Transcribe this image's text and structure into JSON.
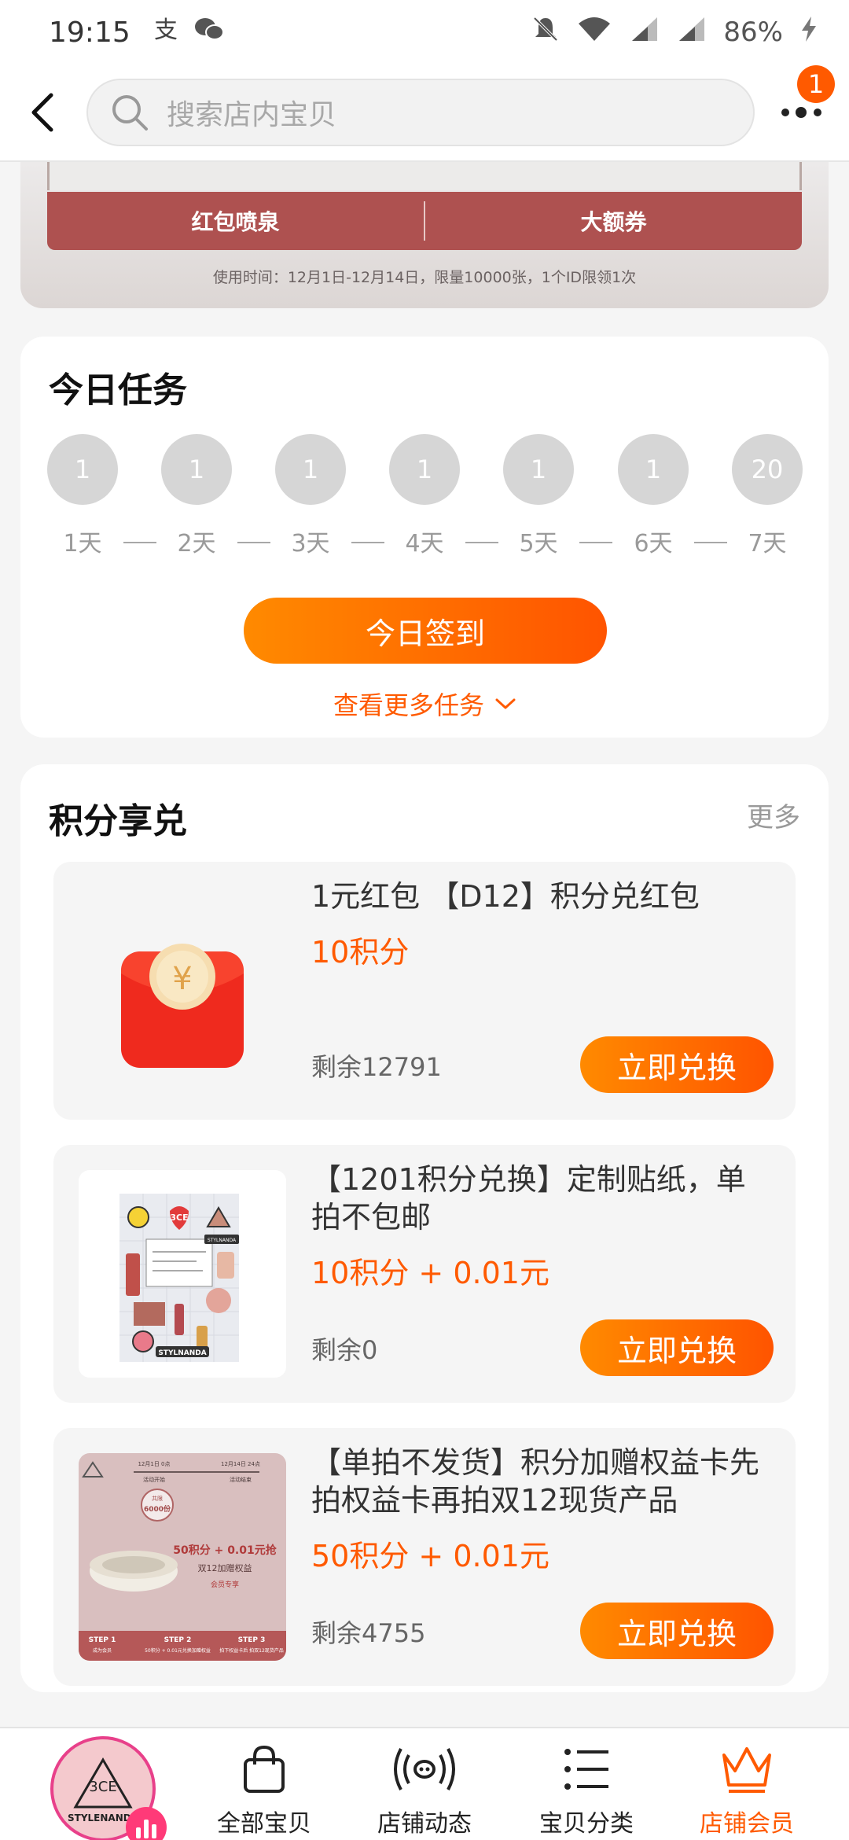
{
  "status_bar": {
    "time": "19:15",
    "left_icons": [
      "alipay-icon",
      "wechat-icon"
    ],
    "right_icons": [
      "mute-icon",
      "wifi-icon",
      "signal-icon",
      "signal-icon",
      "charging-icon"
    ],
    "battery": "86%"
  },
  "nav": {
    "back_icon": "back-arrow-icon",
    "search_placeholder": "搜索店内宝贝",
    "more_icon": "more-dots-icon",
    "badge_count": "1"
  },
  "banner": {
    "tabs": [
      "红包喷泉",
      "大额券"
    ],
    "note": "使用时间：12月1日-12月14日，限量10000张，1个ID限领1次"
  },
  "tasks": {
    "title": "今日任务",
    "days": [
      {
        "points": "1",
        "label": "1天"
      },
      {
        "points": "1",
        "label": "2天"
      },
      {
        "points": "1",
        "label": "3天"
      },
      {
        "points": "1",
        "label": "4天"
      },
      {
        "points": "1",
        "label": "5天"
      },
      {
        "points": "1",
        "label": "6天"
      },
      {
        "points": "20",
        "label": "7天"
      }
    ],
    "checkin_button": "今日签到",
    "more_tasks": "查看更多任务"
  },
  "points_exchange": {
    "title": "积分享兑",
    "more": "更多",
    "items": [
      {
        "title": "1元红包 【D12】积分兑红包",
        "price": "10积分",
        "stock": "剩余12791",
        "button": "立即兑换",
        "image": "red-envelope-icon"
      },
      {
        "title": "【1201积分兑换】定制贴纸，单拍不包邮",
        "price": "10积分 + 0.01元",
        "stock": "剩余0",
        "button": "立即兑换",
        "image": "sticker-sheet-image",
        "image_text": [
          "3CE",
          "STYLNANDA",
          "STYLNANDA"
        ]
      },
      {
        "title": "【单拍不发货】积分加赠权益卡先拍权益卡再拍双12现货产品",
        "price": "50积分 + 0.01元",
        "stock": "剩余4755",
        "button": "立即兑换",
        "image": "benefit-card-image",
        "image_text": {
          "header_dates": [
            "12月1日 0点",
            "12月14日 24点"
          ],
          "header_labels": [
            "活动开始",
            "活动结束"
          ],
          "stamp": "6000份",
          "stamp_top": "共限",
          "headline": "50积分 + 0.01元抢",
          "subline": "双12加赠权益",
          "tag": "会员专享",
          "steps": [
            {
              "step": "STEP 1",
              "desc": "成为会员"
            },
            {
              "step": "STEP 2",
              "desc": "50积分 + 0.01元兑换加赠权益"
            },
            {
              "step": "STEP 3",
              "desc": "拍下权益卡后 拍双12现货产品"
            }
          ]
        }
      }
    ]
  },
  "tabbar": {
    "logo_text": "STYLENANDA",
    "logo_mark": "3CE",
    "tabs": [
      {
        "label": "全部宝贝",
        "icon": "shopping-bag-icon"
      },
      {
        "label": "店铺动态",
        "icon": "broadcast-icon"
      },
      {
        "label": "宝贝分类",
        "icon": "list-icon"
      },
      {
        "label": "店铺会员",
        "icon": "crown-icon",
        "active": true
      }
    ]
  },
  "colors": {
    "accent": "#ff5a00",
    "gradient_start": "#ff8a00",
    "gradient_end": "#ff5400",
    "banner_red": "#ae5150",
    "inactive_circle": "#d6d6d6"
  }
}
